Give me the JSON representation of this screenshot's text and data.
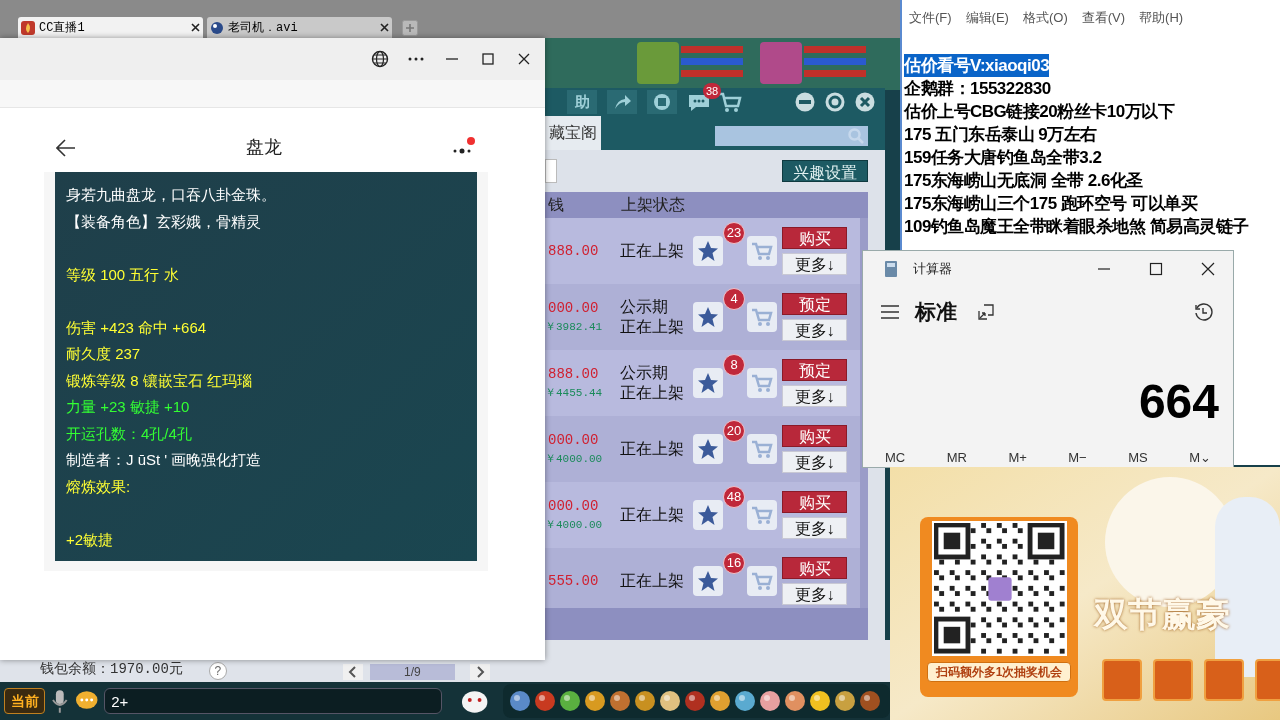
{
  "top_tabs": [
    {
      "label": "CC直播1",
      "selected": true
    },
    {
      "label": "老司机．avi",
      "selected": false
    }
  ],
  "game": {
    "toolbar": {
      "help_label": "助",
      "message_count": "38"
    },
    "tab": "藏宝阁",
    "interest_button": "兴趣设置",
    "columns": [
      "钱",
      "上架状态"
    ],
    "rows": [
      {
        "price": "888.00",
        "status": [
          "正在上架"
        ],
        "fav_count": "23",
        "action": "购买",
        "more": "更多↓"
      },
      {
        "price": "000.00",
        "subprice": "￥3982.41",
        "status": [
          "公示期",
          "正在上架"
        ],
        "fav_count": "4",
        "action": "预定",
        "more": "更多↓"
      },
      {
        "price": "888.00",
        "subprice": "￥4455.44",
        "status": [
          "公示期",
          "正在上架"
        ],
        "fav_count": "8",
        "action": "预定",
        "more": "更多↓"
      },
      {
        "price": "000.00",
        "subprice": "￥4000.00",
        "status": [
          "正在上架"
        ],
        "fav_count": "20",
        "action": "购买",
        "more": "更多↓"
      },
      {
        "price": "000.00",
        "subprice": "￥4000.00",
        "status": [
          "正在上架"
        ],
        "fav_count": "48",
        "action": "购买",
        "more": "更多↓"
      },
      {
        "price": "555.00",
        "status": [
          "正在上架"
        ],
        "fav_count": "16",
        "action": "购买",
        "more": "更多↓"
      }
    ],
    "wallet": "钱包余额：1970.00元",
    "help": "?",
    "pager": "1/9",
    "chat": {
      "channel": "当前",
      "input_value": "2+"
    }
  },
  "popup": {
    "title": "盘龙",
    "lines": [
      {
        "kind": "line",
        "text": "身若九曲盘龙，口吞八卦金珠。",
        "color": "#ffffff"
      },
      {
        "kind": "line",
        "text": "【装备角色】玄彩娥，骨精灵",
        "color": "#ffffff"
      },
      {
        "kind": "spacer"
      },
      {
        "kind": "line",
        "text": "等级 100 五行 水",
        "color": "#ffff33"
      },
      {
        "kind": "spacer"
      },
      {
        "kind": "line",
        "text": "伤害 +423 命中 +664",
        "color": "#ffff33"
      },
      {
        "kind": "line",
        "text": "耐久度 237",
        "color": "#ffff33"
      },
      {
        "kind": "line",
        "text": "锻炼等级 8 镶嵌宝石 红玛瑙",
        "color": "#ffff33"
      },
      {
        "kind": "line",
        "text": "力量 +23 敏捷 +10",
        "color": "#33ff33"
      },
      {
        "kind": "line",
        "text": "开运孔数：4孔/4孔",
        "color": "#33ff33"
      },
      {
        "kind": "line",
        "text": "制造者：J ūSt ' 画晚强化打造",
        "color": "#ffffff"
      },
      {
        "kind": "line",
        "text": "熔炼效果:",
        "color": "#ffff33"
      },
      {
        "kind": "spacer"
      },
      {
        "kind": "line",
        "text": "+2敏捷",
        "color": "#ffff33"
      }
    ]
  },
  "notepad": {
    "menu": [
      "文件(F)",
      "编辑(E)",
      "格式(O)",
      "查看(V)",
      "帮助(H)"
    ],
    "lines": [
      {
        "text": "估价看号V:xiaoqi03",
        "highlighted": true
      },
      {
        "text": "企鹅群：155322830",
        "highlighted": false
      },
      {
        "text": "估价上号CBG链接20粉丝卡10万以下",
        "highlighted": false
      },
      {
        "text": "175 五门东岳泰山  9万左右",
        "highlighted": false
      },
      {
        "text": "159任务大唐钓鱼岛全带3.2",
        "highlighted": false
      },
      {
        "text": "175东海崂山无底洞  全带   2.6化圣",
        "highlighted": false
      },
      {
        "text": "175东海崂山三个175 跑环空号 可以单买",
        "highlighted": false
      },
      {
        "text": "109钓鱼岛魔王全带眯着眼杀地煞 简易高灵链子",
        "highlighted": false
      }
    ]
  },
  "calculator": {
    "title": "计算器",
    "mode": "标准",
    "display": "664",
    "memory_buttons": [
      "MC",
      "MR",
      "M+",
      "M−",
      "MS",
      "M⌄"
    ]
  },
  "banner": {
    "caption": "扫码额外多1次抽奖机会",
    "title": "双节赢豪"
  }
}
